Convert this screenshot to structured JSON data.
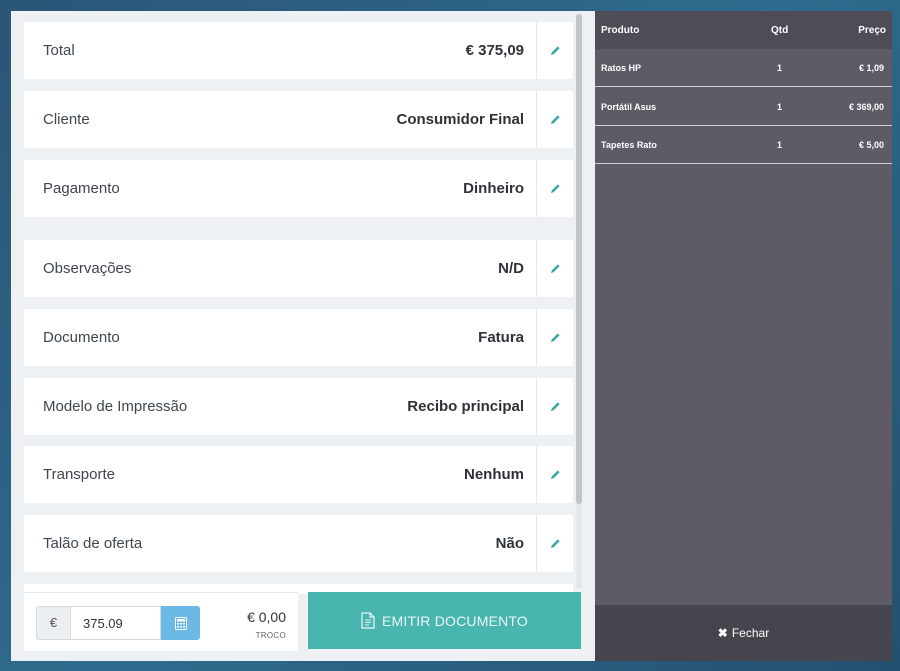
{
  "summary": {
    "rows": [
      {
        "label": "Total",
        "value": "€ 375,09"
      },
      {
        "label": "Cliente",
        "value": "Consumidor Final"
      },
      {
        "label": "Pagamento",
        "value": "Dinheiro"
      },
      {
        "label": "Observações",
        "value": "N/D"
      },
      {
        "label": "Documento",
        "value": "Fatura"
      },
      {
        "label": "Modelo de Impressão",
        "value": "Recibo principal"
      },
      {
        "label": "Transporte",
        "value": "Nenhum"
      },
      {
        "label": "Talão de oferta",
        "value": "Não"
      }
    ]
  },
  "payment": {
    "currency_symbol": "€",
    "amount": "375.09",
    "change_value": "€ 0,00",
    "change_label": "TROCO"
  },
  "emit_button": {
    "label": "EMITIR DOCUMENTO"
  },
  "items_table": {
    "headers": {
      "product": "Produto",
      "qty": "Qtd",
      "price": "Preço"
    },
    "rows": [
      {
        "product": "Ratos HP",
        "qty": "1",
        "price": "€ 1,09"
      },
      {
        "product": "Portátil Asus",
        "qty": "1",
        "price": "€ 369,00"
      },
      {
        "product": "Tapetes Rato",
        "qty": "1",
        "price": "€ 5,00"
      }
    ]
  },
  "close_button": {
    "label": "Fechar"
  },
  "colors": {
    "accent": "#48b5ae",
    "edit_icon": "#3aa6a0",
    "calc_button": "#6cb9e6",
    "sidebar_bg": "#5e5b66"
  },
  "icons": {
    "edit": "pencil-icon",
    "calculator": "calculator-icon",
    "document": "document-icon",
    "close": "close-icon"
  }
}
